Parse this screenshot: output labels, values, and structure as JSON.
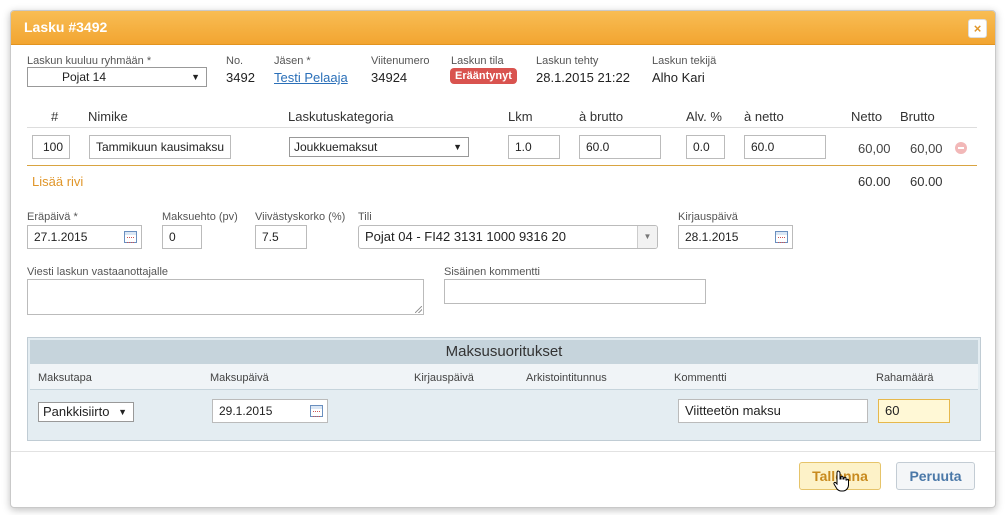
{
  "modal": {
    "title": "Lasku #3492",
    "close_symbol": "×"
  },
  "info": {
    "group_label": "Laskun kuuluu ryhmään *",
    "group_value": "Pojat 14",
    "no_label": "No.",
    "no_value": "3492",
    "member_label": "Jäsen *",
    "member_value": "Testi Pelaaja",
    "reference_label": "Viitenumero",
    "reference_value": "34924",
    "status_label": "Laskun tila",
    "status_value": "Erääntynyt",
    "created_label": "Laskun tehty",
    "created_value": "28.1.2015 21:22",
    "author_label": "Laskun tekijä",
    "author_value": "Alho Kari"
  },
  "rows_table": {
    "headers": {
      "num": "#",
      "item": "Nimike",
      "category": "Laskutuskategoria",
      "qty": "Lkm",
      "gross_unit": "à brutto",
      "vat": "Alv. %",
      "net_unit": "à netto",
      "net": "Netto",
      "gross": "Brutto"
    },
    "row": {
      "num": "100",
      "item": "Tammikuun kausimaksu",
      "category": "Joukkuemaksut",
      "qty": "1.0",
      "gross_unit": "60.0",
      "vat": "0.0",
      "net_unit": "60.0",
      "net": "60,00",
      "gross": "60,00"
    },
    "add_row": "Lisää rivi",
    "total_net": "60.00",
    "total_gross": "60.00"
  },
  "details": {
    "due_label": "Eräpäivä *",
    "due_value": "27.1.2015",
    "terms_label": "Maksuehto (pv)",
    "terms_value": "0",
    "interest_label": "Viivästyskorko (%)",
    "interest_value": "7.5",
    "account_label": "Tili",
    "account_value": "Pojat 04 - FI42 3131 1000 9316 20",
    "booking_label": "Kirjauspäivä",
    "booking_value": "28.1.2015",
    "message_label": "Viesti laskun vastaanottajalle",
    "comment_label": "Sisäinen kommentti"
  },
  "payments": {
    "title": "Maksusuoritukset",
    "headers": {
      "method": "Maksutapa",
      "date": "Maksupäivä",
      "booking": "Kirjauspäivä",
      "archive": "Arkistointitunnus",
      "comment": "Kommentti",
      "amount": "Rahamäärä"
    },
    "row": {
      "method": "Pankkisiirto",
      "date": "29.1.2015",
      "comment": "Viitteetön maksu",
      "amount": "60"
    }
  },
  "buttons": {
    "save": "Tallenna",
    "cancel": "Peruuta"
  },
  "colors": {
    "header": "#f2a531",
    "status_badge": "#d9534f",
    "add_row": "#e0962a",
    "link": "#2a6fb8"
  }
}
